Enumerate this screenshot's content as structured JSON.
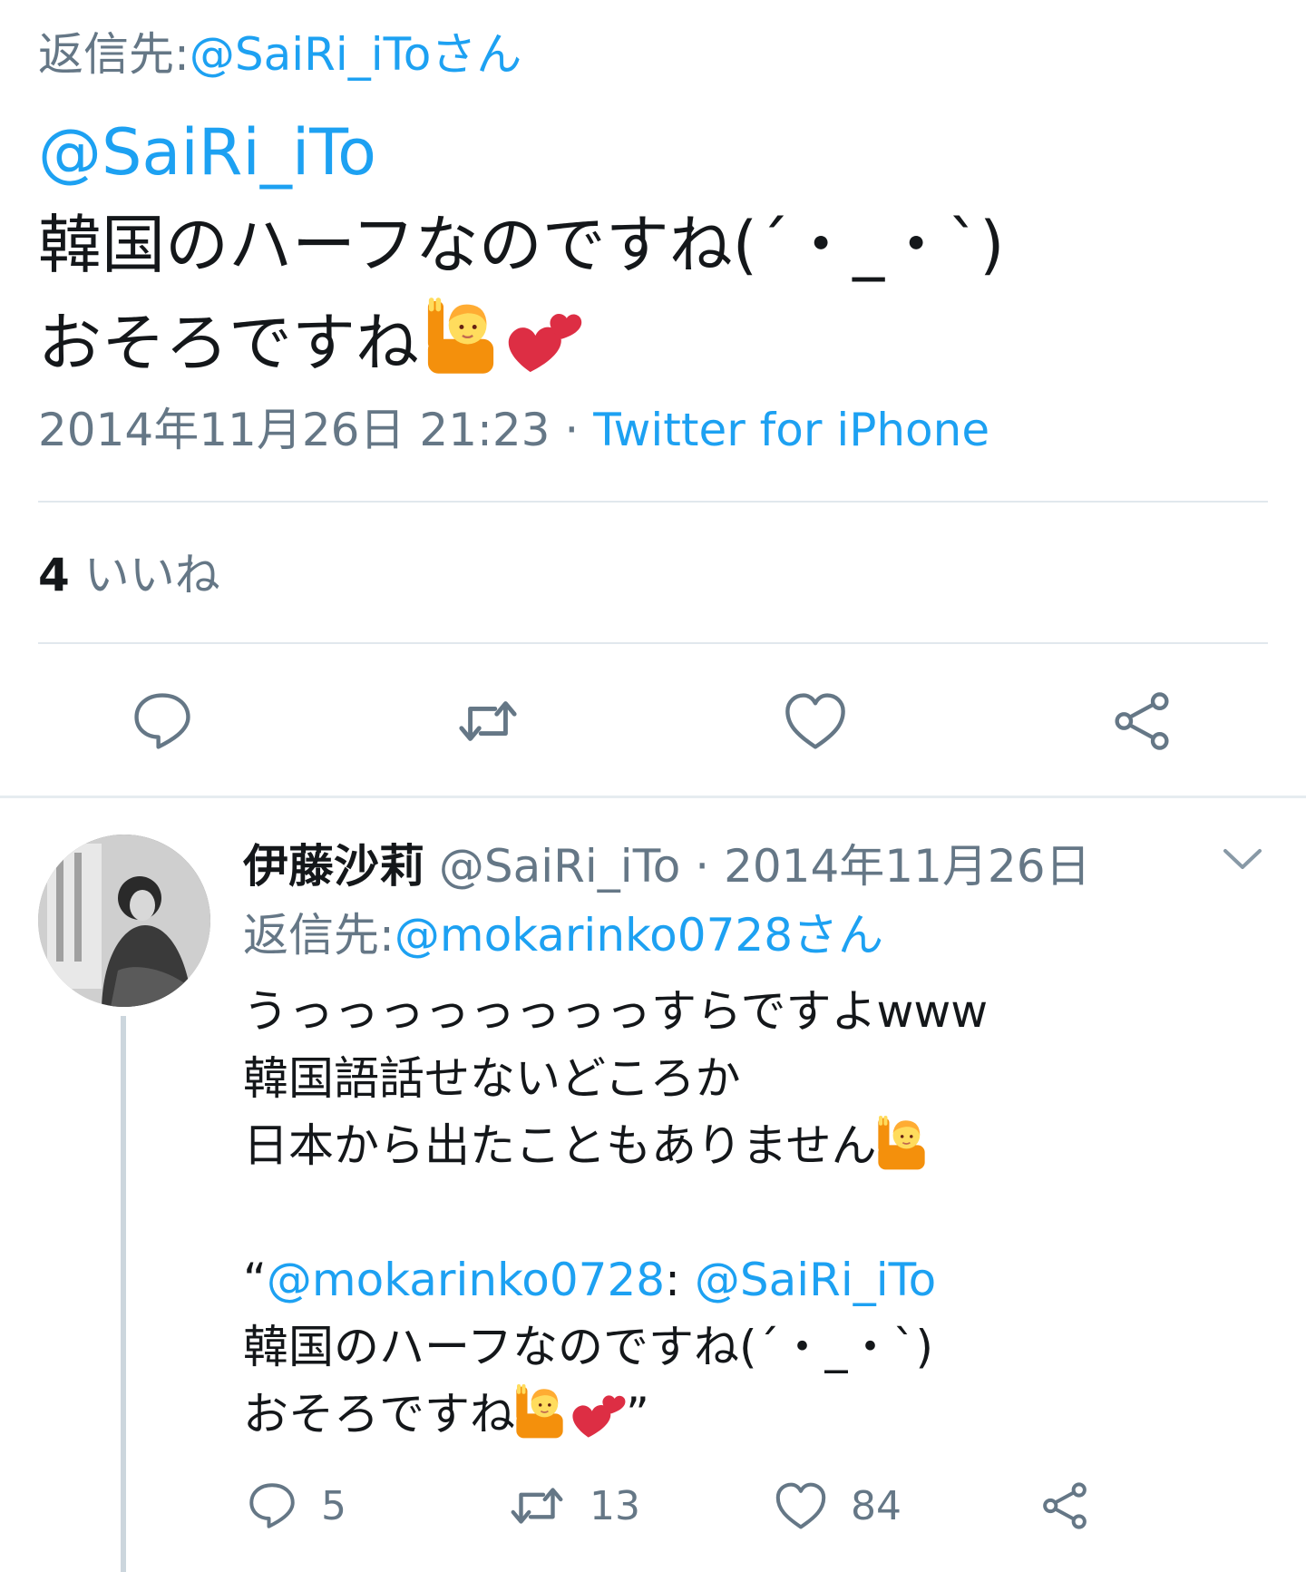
{
  "main_tweet": {
    "reply_to_label": "返信先:",
    "reply_to_user": "@SaiRi_iToさん",
    "mention": "@SaiRi_iTo",
    "text_line1": "韓国のハーフなのですね(´・_・`)",
    "text_line2": "おそろですね",
    "timestamp": "2014年11月26日 21:23",
    "separator": "·",
    "source": "Twitter for iPhone",
    "likes_count": "4",
    "likes_label": "いいね"
  },
  "reply_tweet": {
    "author_name": "伊藤沙莉",
    "author_handle": "@SaiRi_iTo",
    "separator": "·",
    "date": "2014年11月26日",
    "reply_to_label": "返信先:",
    "reply_to_user": "@mokarinko0728さん",
    "line1": "うっっっっっっっっすらですよwww",
    "line2": "韓国語話せないどころか",
    "line3": "日本から出たこともありません",
    "quote_open": "“",
    "quote_user": "@mokarinko0728",
    "quote_colon": ":",
    "quote_mention": "@SaiRi_iTo",
    "quote_line1": "韓国のハーフなのですね(´・_・`)",
    "quote_line2": "おそろですね",
    "quote_close": "”",
    "reply_count": "5",
    "retweet_count": "13",
    "like_count": "84"
  },
  "icons": {
    "reply": "reply-icon",
    "retweet": "retweet-icon",
    "like": "heart-icon",
    "share": "share-icon",
    "chevron": "chevron-down-icon",
    "emoji_raise_hand": "person-raising-hand-emoji",
    "emoji_hearts": "two-hearts-emoji"
  },
  "colors": {
    "link_blue": "#1da1f2",
    "secondary_gray": "#657786",
    "text_black": "#14171a",
    "divider": "#e1e8ed"
  }
}
